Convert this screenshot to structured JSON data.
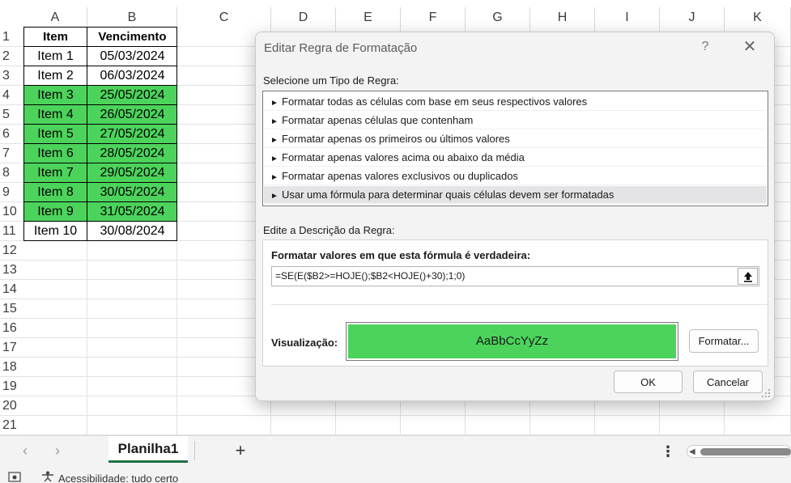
{
  "spreadsheet": {
    "columns": [
      "A",
      "B",
      "C",
      "D",
      "E",
      "F",
      "G",
      "H",
      "I",
      "J",
      "K"
    ],
    "rows": [
      "1",
      "2",
      "3",
      "4",
      "5",
      "6",
      "7",
      "8",
      "9",
      "10",
      "11",
      "12",
      "13",
      "14",
      "15",
      "16",
      "17",
      "18",
      "19",
      "20",
      "21"
    ],
    "header": {
      "item": "Item",
      "due": "Vencimento"
    },
    "data": [
      {
        "item": "Item 1",
        "due": "05/03/2024",
        "highlight": false
      },
      {
        "item": "Item 2",
        "due": "06/03/2024",
        "highlight": false
      },
      {
        "item": "Item 3",
        "due": "25/05/2024",
        "highlight": true
      },
      {
        "item": "Item 4",
        "due": "26/05/2024",
        "highlight": true
      },
      {
        "item": "Item 5",
        "due": "27/05/2024",
        "highlight": true
      },
      {
        "item": "Item 6",
        "due": "28/05/2024",
        "highlight": true
      },
      {
        "item": "Item 7",
        "due": "29/05/2024",
        "highlight": true
      },
      {
        "item": "Item 8",
        "due": "30/05/2024",
        "highlight": true
      },
      {
        "item": "Item 9",
        "due": "31/05/2024",
        "highlight": true
      },
      {
        "item": "Item 10",
        "due": "30/08/2024",
        "highlight": false
      }
    ],
    "highlight_color": "#4cd35c"
  },
  "dialog": {
    "title": "Editar Regra de Formatação",
    "help_icon": "?",
    "close_icon": "✕",
    "rule_type_label": "Selecione um Tipo de Regra:",
    "rule_types": [
      "Formatar todas as células com base em seus respectivos valores",
      "Formatar apenas células que contenham",
      "Formatar apenas os primeiros ou últimos valores",
      "Formatar apenas valores acima ou abaixo da média",
      "Formatar apenas valores exclusivos ou duplicados",
      "Usar uma fórmula para determinar quais células devem ser formatadas"
    ],
    "selected_rule_index": 5,
    "description_label": "Edite a Descrição da Regra:",
    "formula_label": "Formatar valores em que esta fórmula é verdadeira:",
    "formula_value": "=SE(E($B2>=HOJE();$B2<HOJE()+30);1;0)",
    "preview_label": "Visualização:",
    "preview_text": "AaBbCcYyZz",
    "format_button": "Formatar...",
    "ok_button": "OK",
    "cancel_button": "Cancelar"
  },
  "tabs": {
    "sheet_name": "Planilha1",
    "add_icon": "+",
    "more_icon": "⋮"
  },
  "status": {
    "accessibility": "Acessibilidade: tudo certo"
  }
}
